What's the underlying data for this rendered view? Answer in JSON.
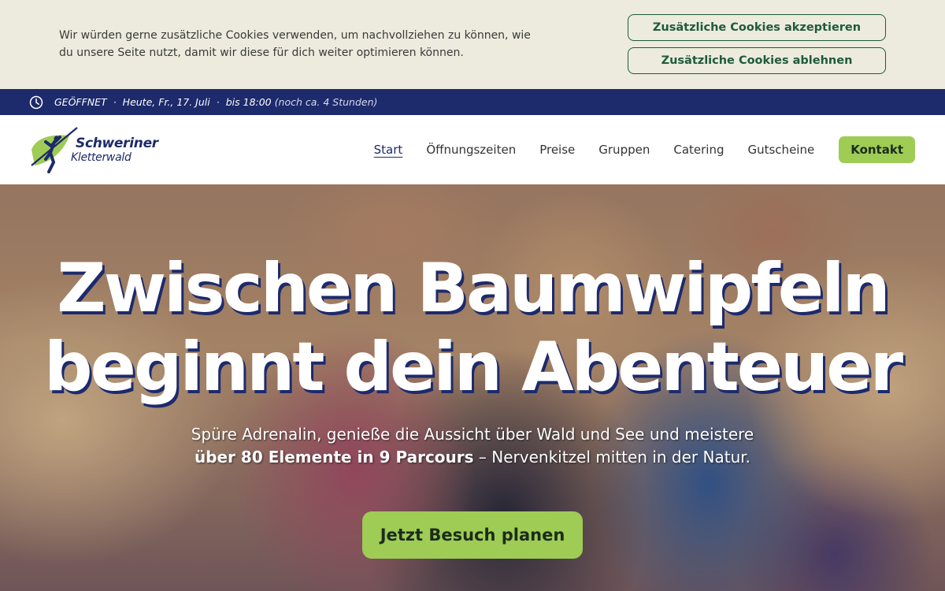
{
  "cookie_banner": {
    "text": "Wir würden gerne zusätzliche Cookies verwenden, um nachvollziehen zu können, wie du unsere Seite nutzt, damit wir diese für dich weiter optimieren können.",
    "accept_label": "Zusätzliche Cookies akzeptieren",
    "decline_label": "Zusätzliche Cookies ablehnen"
  },
  "status_bar": {
    "icon": "clock-icon",
    "state": "GEÖFFNET",
    "day": "Heute, Fr., 17. Juli",
    "hours": "bis 18:00",
    "note": "(noch ca. 4 Stunden)"
  },
  "header": {
    "logo_line1": "Schweriner",
    "logo_line2": "Kletterwald",
    "nav": [
      "Start",
      "Öffnungszeiten",
      "Preise",
      "Gruppen",
      "Catering",
      "Gutscheine"
    ],
    "contact_label": "Kontakt"
  },
  "hero": {
    "title_line1": "Zwischen Baumwipfeln",
    "title_line2": "beginnt dein Abenteuer",
    "subtitle_line1": "Spüre Adrenalin, genieße die Aussicht über Wald und See und meistere",
    "subtitle_bold": "über 80 Elemente in 9 Parcours",
    "subtitle_rest": " – Nervenkitzel mitten in der Natur.",
    "cta_label": "Jetzt Besuch planen"
  },
  "colors": {
    "brand_navy": "#1d2a6b",
    "brand_green": "#9ecc55",
    "cookie_bg": "#ecebdd",
    "cookie_button": "#1f5a3d"
  }
}
